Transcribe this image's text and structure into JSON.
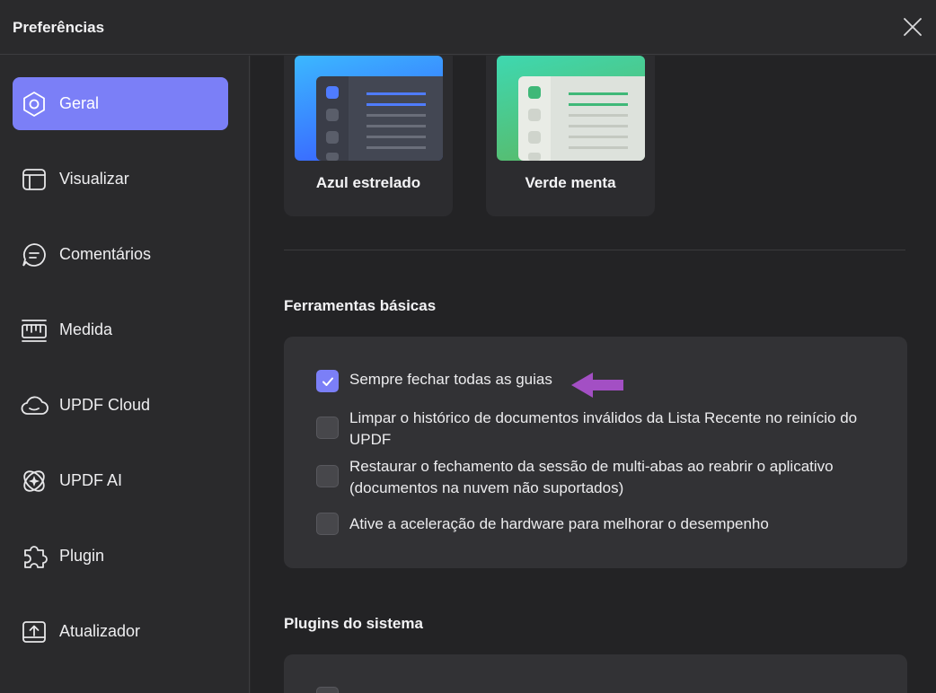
{
  "window": {
    "title": "Preferências"
  },
  "sidebar": {
    "items": [
      {
        "label": "Geral",
        "icon": "gear-icon",
        "active": true
      },
      {
        "label": "Visualizar",
        "icon": "layout-icon"
      },
      {
        "label": "Comentários",
        "icon": "comment-icon"
      },
      {
        "label": "Medida",
        "icon": "ruler-icon"
      },
      {
        "label": "UPDF Cloud",
        "icon": "cloud-icon"
      },
      {
        "label": "UPDF AI",
        "icon": "ai-icon"
      },
      {
        "label": "Plugin",
        "icon": "puzzle-icon"
      },
      {
        "label": "Atualizador",
        "icon": "updater-icon"
      }
    ]
  },
  "themes": [
    {
      "name": "Azul estrelado",
      "accent": "#4f7cff"
    },
    {
      "name": "Verde menta",
      "accent": "#3fb878"
    }
  ],
  "basic_tools": {
    "title": "Ferramentas básicas",
    "options": [
      {
        "label": "Sempre fechar todas as guias",
        "checked": true
      },
      {
        "label": "Limpar o histórico de documentos inválidos da Lista Recente no reinício do UPDF",
        "checked": false
      },
      {
        "label": "Restaurar o fechamento da sessão de multi-abas ao reabrir o aplicativo (documentos na nuvem não suportados)",
        "checked": false
      },
      {
        "label": "Ative a aceleração de hardware para melhorar o desempenho",
        "checked": false
      }
    ]
  },
  "system_plugins": {
    "title": "Plugins do sistema"
  },
  "colors": {
    "accent": "#7b7ff7",
    "annotation_arrow": "#a34fc4"
  }
}
